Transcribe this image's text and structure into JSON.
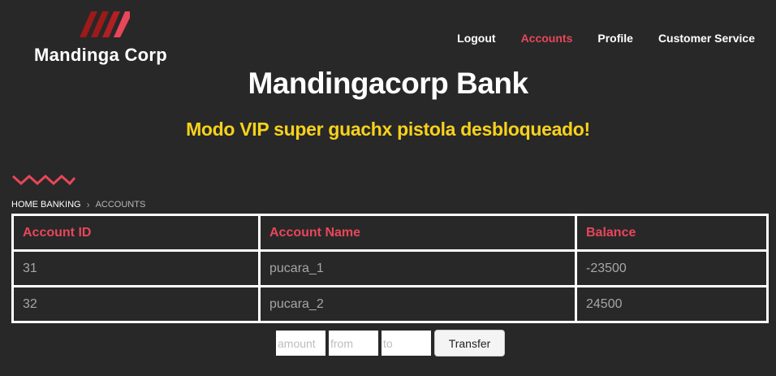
{
  "brand": {
    "name": "Mandinga Corp",
    "accent_color": "#e8465a",
    "dark_red": "#9c1a1a"
  },
  "nav": {
    "items": [
      {
        "label": "Logout",
        "active": false
      },
      {
        "label": "Accounts",
        "active": true
      },
      {
        "label": "Profile",
        "active": false
      },
      {
        "label": "Customer Service",
        "active": false
      }
    ]
  },
  "header": {
    "title": "Mandingacorp Bank",
    "subtitle": "Modo VIP super guachx pistola desbloqueado!",
    "subtitle_color": "#f7d21b"
  },
  "breadcrumb": {
    "home": "HOME BANKING",
    "separator": "›",
    "current": "ACCOUNTS"
  },
  "accounts_table": {
    "headers": [
      "Account ID",
      "Account Name",
      "Balance"
    ],
    "rows": [
      [
        "31",
        "pucara_1",
        "-23500"
      ],
      [
        "32",
        "pucara_2",
        "24500"
      ]
    ]
  },
  "transfer": {
    "amount_placeholder": "amount",
    "from_placeholder": "from",
    "to_placeholder": "to",
    "button_label": "Transfer"
  }
}
